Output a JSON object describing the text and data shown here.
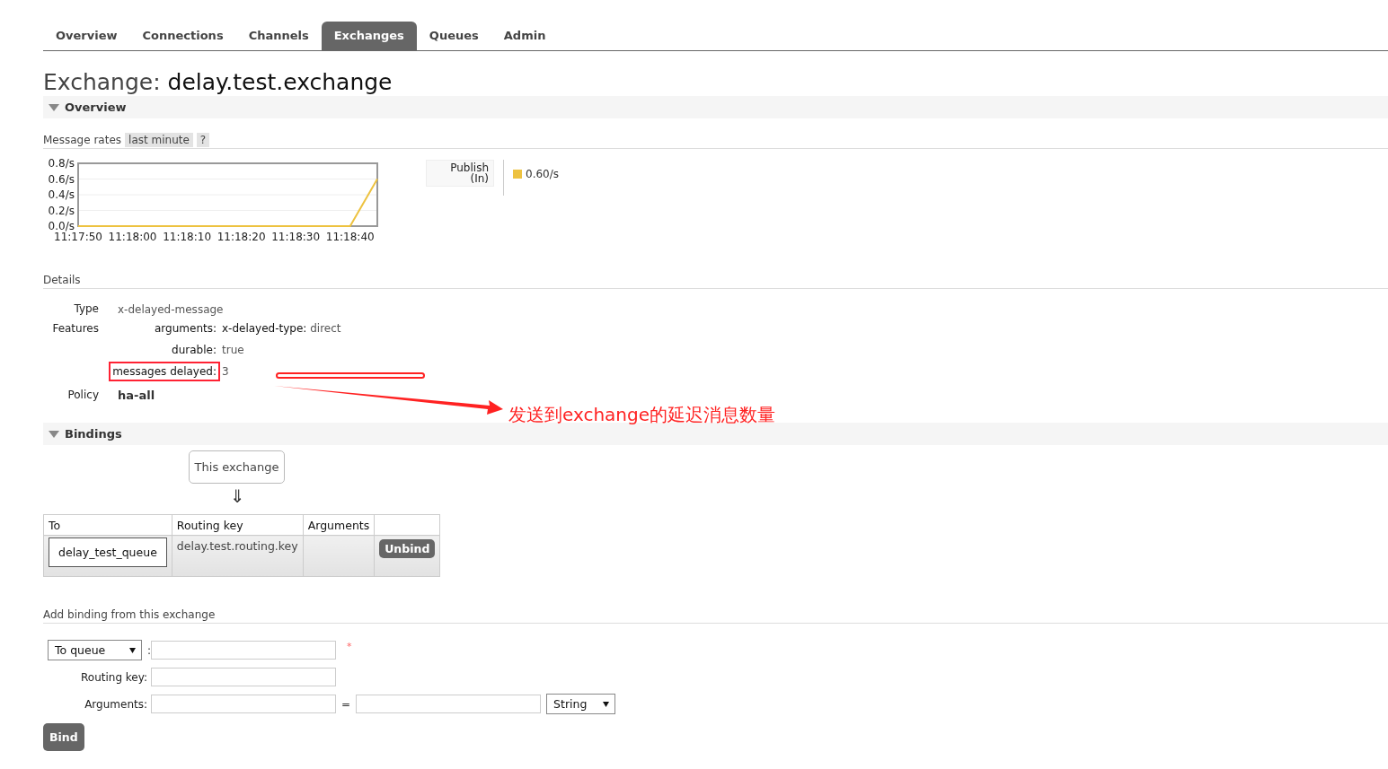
{
  "tabs": [
    {
      "label": "Overview",
      "selected": false
    },
    {
      "label": "Connections",
      "selected": false
    },
    {
      "label": "Channels",
      "selected": false
    },
    {
      "label": "Exchanges",
      "selected": true
    },
    {
      "label": "Queues",
      "selected": false
    },
    {
      "label": "Admin",
      "selected": false
    }
  ],
  "page_title": {
    "prefix": "Exchange:",
    "name": "delay.test.exchange"
  },
  "overview": {
    "title": "Overview",
    "expanded": true,
    "rates_heading": "Message rates",
    "range": "last minute",
    "help": "?",
    "chart_data": {
      "type": "line",
      "categories": [
        "11:17:50",
        null,
        "11:18:00",
        null,
        "11:18:10",
        null,
        "11:18:20",
        null,
        "11:18:30",
        null,
        "11:18:40",
        null
      ],
      "series": [
        {
          "name": "Publish (In)",
          "color": "#edc240",
          "values": [
            0,
            0,
            0,
            0,
            0,
            0,
            0,
            0,
            0,
            0,
            0,
            0.6
          ]
        }
      ],
      "ylim": [
        0,
        0.8
      ],
      "grid": true,
      "yticks": [
        {
          "value": 0,
          "label": "0.0/s"
        },
        {
          "value": 0.2,
          "label": "0.2/s"
        },
        {
          "value": 0.4,
          "label": "0.4/s"
        },
        {
          "value": 0.6,
          "label": "0.6/s"
        },
        {
          "value": 0.8,
          "label": "0.8/s"
        }
      ]
    },
    "rate": "0.60/s",
    "details_heading": "Details",
    "type_label": "Type",
    "type_value": "x-delayed-message",
    "features_label": "Features",
    "features": [
      {
        "kind": "args",
        "label": "arguments:",
        "args": [
          {
            "label": "x-delayed-type:",
            "value": "direct"
          }
        ],
        "highlighted": false
      },
      {
        "kind": "plain",
        "label": "durable:",
        "value": "true",
        "highlighted": false
      },
      {
        "kind": "plain",
        "label": "messages delayed:",
        "value": "3",
        "highlighted": true
      }
    ],
    "policy_label": "Policy",
    "policy_value": "ha-all"
  },
  "annotation": {
    "text": "发送到exchange的延迟消息数量"
  },
  "bindings": {
    "title": "Bindings",
    "expanded": true,
    "source": "This exchange",
    "arrow": "⇓",
    "columns": [
      "To",
      "Routing key",
      "Arguments"
    ],
    "rows": [
      {
        "to": "delay_test_queue",
        "routing_key": "delay.test.routing.key",
        "action": "Unbind"
      }
    ]
  },
  "add_binding": {
    "heading": "Add binding from this exchange",
    "destination": "To queue",
    "separator": ":",
    "required_mark": "*",
    "routing_key_label": "Routing key:",
    "arguments_label": "Arguments:",
    "equals": "=",
    "arg_type": "String",
    "bind": "Bind"
  }
}
